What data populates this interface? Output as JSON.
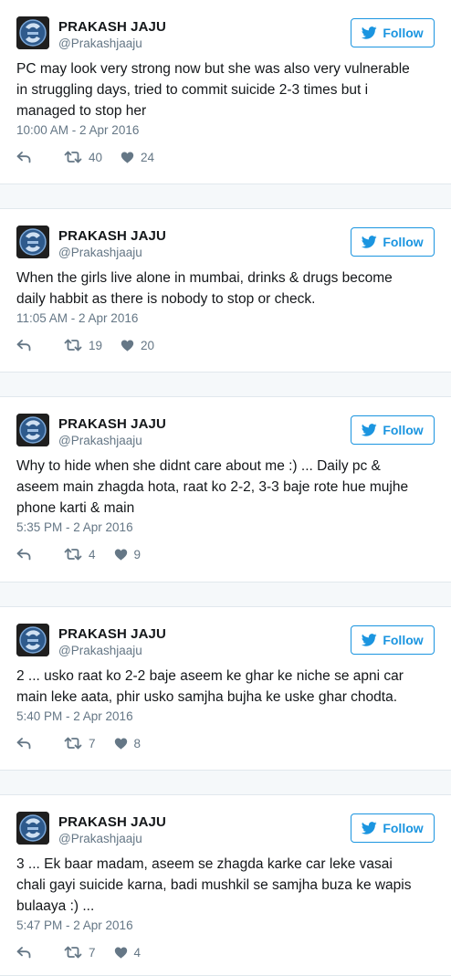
{
  "colors": {
    "follow_blue": "#1b95e0",
    "meta_gray": "#657786",
    "text": "#14171a",
    "divider": "#e1e8ed",
    "gap_bg": "#f5f8fa"
  },
  "icons": {
    "follow": "twitter-bird-icon",
    "reply": "reply-arrow-icon",
    "retweet": "retweet-icon",
    "like": "heart-icon"
  },
  "tweets": [
    {
      "name": "PRAKASH JAJU",
      "handle": "@Prakashjaaju",
      "follow_label": "Follow",
      "lines": [
        "PC may look very strong now but she was also very vulnerable",
        "in struggling days, tried to commit suicide 2-3 times but i",
        "managed to stop her"
      ],
      "time": "10:00 AM - 2 Apr 2016",
      "retweets": "40",
      "likes": "24"
    },
    {
      "name": "PRAKASH JAJU",
      "handle": "@Prakashjaaju",
      "follow_label": "Follow",
      "lines": [
        "When the girls live alone in mumbai, drinks & drugs become",
        "daily habbit as there is nobody to stop or check."
      ],
      "time": "11:05 AM - 2 Apr 2016",
      "retweets": "19",
      "likes": "20"
    },
    {
      "name": "PRAKASH JAJU",
      "handle": "@Prakashjaaju",
      "follow_label": "Follow",
      "lines": [
        "Why to hide when she didnt care about me :) ... Daily pc &",
        "aseem main zhagda hota, raat ko 2-2, 3-3 baje rote hue mujhe",
        "phone karti & main"
      ],
      "time": "5:35 PM - 2 Apr 2016",
      "retweets": "4",
      "likes": "9"
    },
    {
      "name": "PRAKASH JAJU",
      "handle": "@Prakashjaaju",
      "follow_label": "Follow",
      "lines": [
        "2 ... usko raat ko 2-2 baje aseem ke ghar ke niche se apni car",
        "main leke aata, phir usko samjha bujha ke uske ghar chodta."
      ],
      "time": "5:40 PM - 2 Apr 2016",
      "retweets": "7",
      "likes": "8"
    },
    {
      "name": "PRAKASH JAJU",
      "handle": "@Prakashjaaju",
      "follow_label": "Follow",
      "lines": [
        "3 ... Ek baar madam, aseem se zhagda karke car leke vasai",
        "chali gayi suicide karna, badi mushkil se samjha buza ke wapis",
        "bulaaya :) ..."
      ],
      "time": "5:47 PM - 2 Apr 2016",
      "retweets": "7",
      "likes": "4"
    }
  ]
}
